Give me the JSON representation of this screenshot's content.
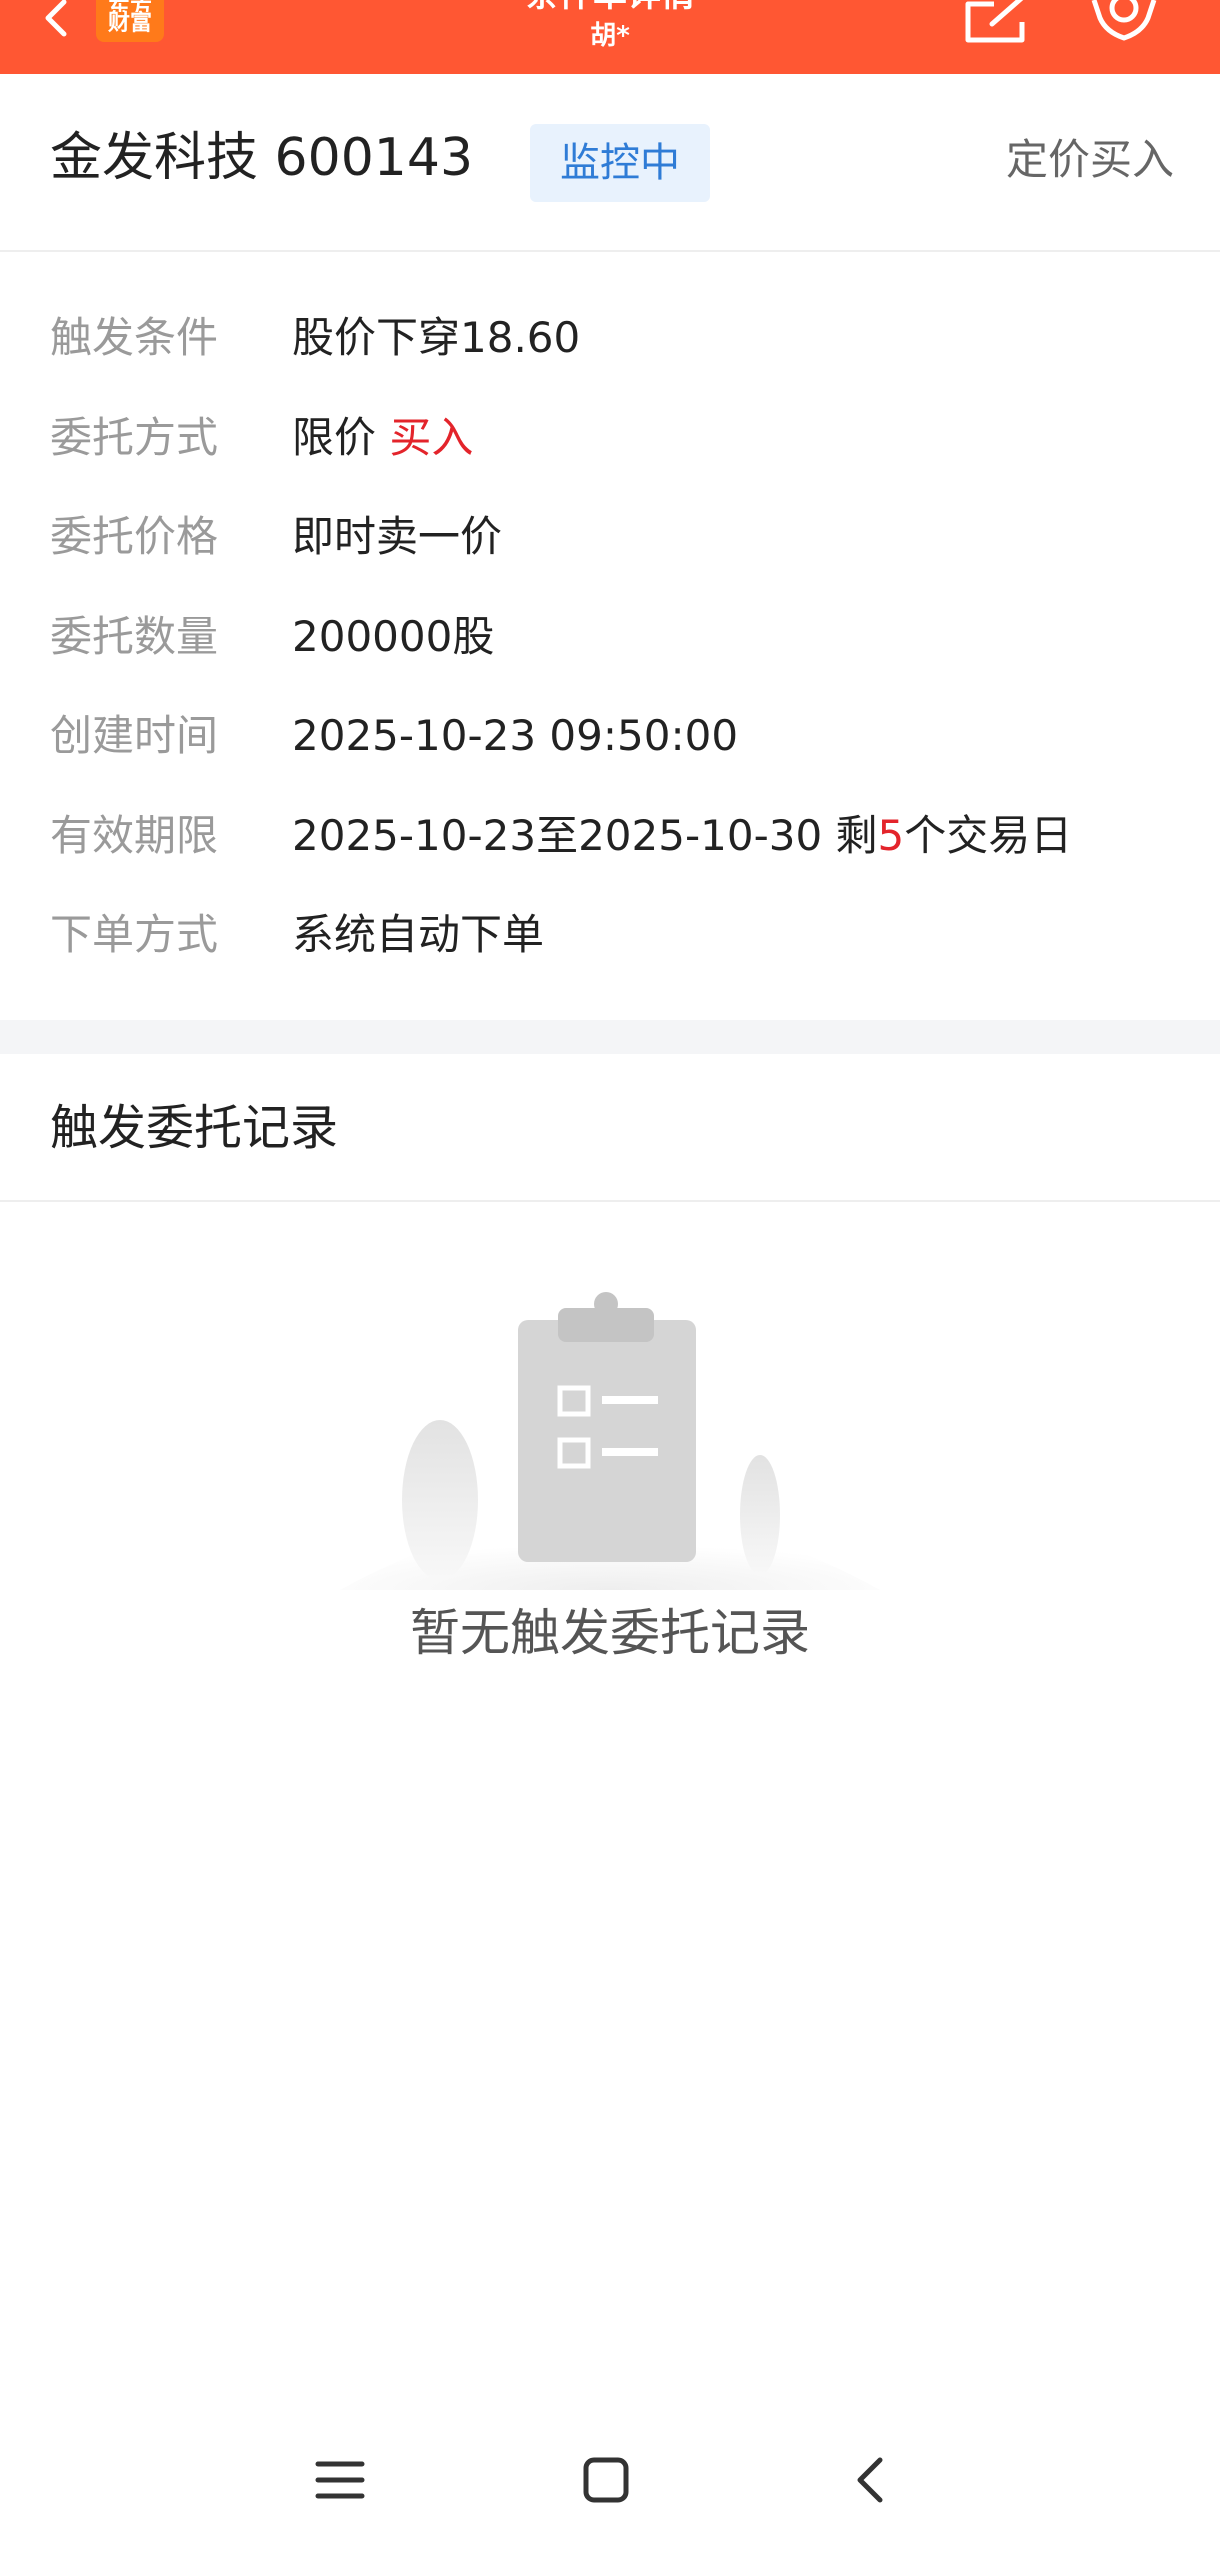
{
  "header": {
    "back_icon": "chevron-left-icon",
    "logo_line1": "东方",
    "logo_line2": "财富",
    "title": "条件单详情",
    "subtitle": "胡*",
    "share_icon": "share-icon",
    "settings_icon": "gear-icon",
    "bg_color": "#ff5733"
  },
  "stock": {
    "name_code": "金发科技 600143",
    "status": "监控中",
    "order_type": "定价买入"
  },
  "details": {
    "trigger_label": "触发条件",
    "trigger_value": "股价下穿18.60",
    "method_label": "委托方式",
    "method_value": "限价",
    "method_side": "买入",
    "price_label": "委托价格",
    "price_value": "即时卖一价",
    "qty_label": "委托数量",
    "qty_value": "200000股",
    "created_label": "创建时间",
    "created_value": "2025-10-23 09:50:00",
    "valid_label": "有效期限",
    "valid_value": "2025-10-23至2025-10-30 剩",
    "valid_days": "5",
    "valid_suffix": "个交易日",
    "place_label": "下单方式",
    "place_value": "系统自动下单"
  },
  "records": {
    "title": "触发委托记录",
    "empty_text": "暂无触发委托记录",
    "empty_icon": "clipboard-icon"
  },
  "navbar": {
    "menu_icon": "menu-icon",
    "home_icon": "home-icon",
    "back_icon": "back-icon"
  },
  "colors": {
    "accent_red": "#e3242b",
    "status_blue": "#2f7cd6"
  }
}
